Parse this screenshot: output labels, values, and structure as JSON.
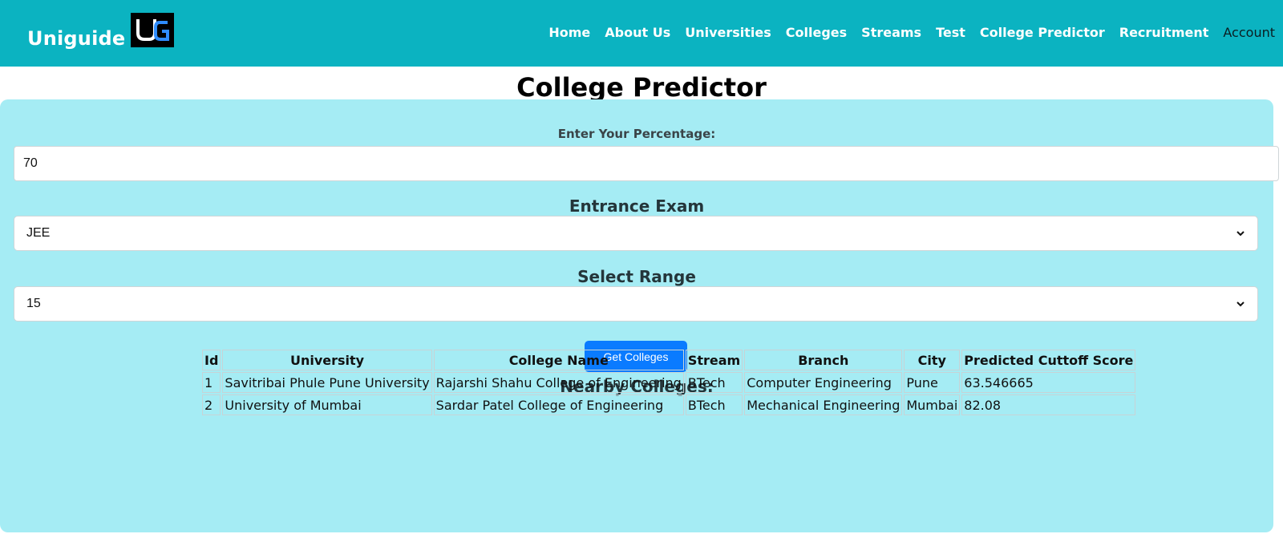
{
  "nav": {
    "brand": "Uniguide",
    "logo_text": "UG",
    "links": [
      "Home",
      "About Us",
      "Universities",
      "Colleges",
      "Streams",
      "Test",
      "College Predictor",
      "Recruitment"
    ],
    "account": "Account"
  },
  "page": {
    "title": "College Predictor"
  },
  "form": {
    "percentage_label": "Enter Your Percentage:",
    "percentage_value": "70",
    "exam_label": "Entrance Exam",
    "exam_value": "JEE",
    "range_label": "Select Range",
    "range_value": "15",
    "submit_label": "Get Colleges"
  },
  "results": {
    "heading": "Nearby Colleges:",
    "columns": [
      "Id",
      "University",
      "College Name",
      "Stream",
      "Branch",
      "City",
      "Predicted Cuttoff Score"
    ],
    "rows": [
      [
        "1",
        "Savitribai Phule Pune University",
        "Rajarshi Shahu College of Engineering",
        "BTech",
        "Computer Engineering",
        "Pune",
        "63.546665"
      ],
      [
        "2",
        "University of Mumbai",
        "Sardar Patel College of Engineering",
        "BTech",
        "Mechanical Engineering",
        "Mumbai",
        "82.08"
      ]
    ]
  },
  "colors": {
    "navbar": "#0bb3c1",
    "panel": "#a5ecf4",
    "button": "#0a7bff"
  }
}
